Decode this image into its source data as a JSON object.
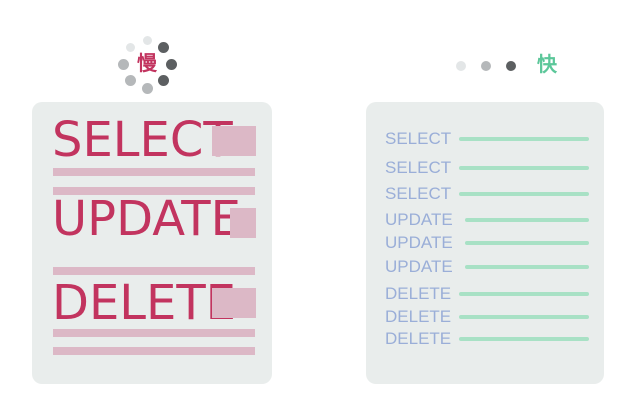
{
  "colors": {
    "panel_bg": "#e9edec",
    "slow_text": "#c2345f",
    "slow_block": "#dcb8c6",
    "fast_text": "#9aaed8",
    "fast_line": "#a8e1c5",
    "label_slow": "#c2345f",
    "label_fast": "#5cc79a",
    "dot_light": "#e3e6e7",
    "dot_mid": "#b5b8ba",
    "dot_dark": "#5c5f61"
  },
  "slow": {
    "label": "慢",
    "icon": "loading-spinner-icon",
    "commands": [
      "SELECT",
      "UPDATE",
      "DELETE"
    ]
  },
  "fast": {
    "label": "快",
    "icon": "loading-dots-icon",
    "commands": [
      "SELECT",
      "SELECT",
      "SELECT",
      "UPDATE",
      "UPDATE",
      "UPDATE",
      "DELETE",
      "DELETE",
      "DELETE"
    ]
  }
}
